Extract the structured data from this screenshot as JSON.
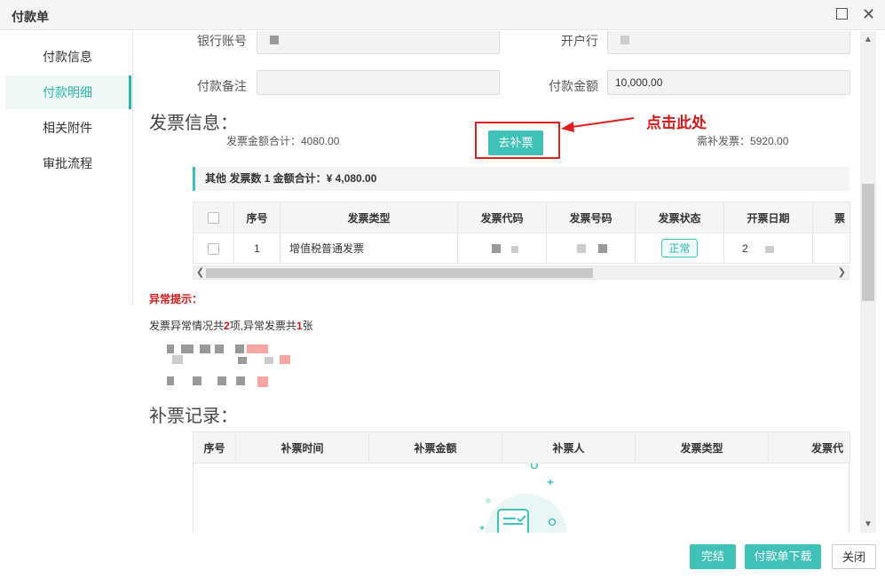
{
  "window": {
    "title": "付款单"
  },
  "sidebar": {
    "items": [
      {
        "label": "付款信息"
      },
      {
        "label": "付款明细"
      },
      {
        "label": "相关附件"
      },
      {
        "label": "审批流程"
      }
    ]
  },
  "form": {
    "bank_account_label": "银行账号",
    "bank_label": "开户行",
    "remark_label": "付款备注",
    "remark_value": "",
    "amount_label": "付款金额",
    "amount_value": "10,000.00"
  },
  "invoice": {
    "section_title": "发票信息：",
    "total_text": "发票金额合计：4080.00",
    "need_text": "需补发票：5920.00",
    "supplement_button": "去补票",
    "annotation": "点击此处",
    "group_bar": "其他 发票数 1 金额合计：¥ 4,080.00",
    "columns": [
      "序号",
      "发票类型",
      "发票代码",
      "发票号码",
      "发票状态",
      "开票日期",
      "票"
    ],
    "rows": [
      {
        "index": "1",
        "type": "增值税普通发票",
        "code": "",
        "number": "",
        "status": "正常",
        "date": "2"
      }
    ]
  },
  "warning": {
    "title": "异常提示：",
    "prefix": "发票异常情况共",
    "count1": "2",
    "mid": "项,异常发票共",
    "count2": "1",
    "suffix": "张"
  },
  "supplement": {
    "section_title": "补票记录：",
    "columns": [
      "序号",
      "补票时间",
      "补票金额",
      "补票人",
      "发票类型",
      "发票代"
    ]
  },
  "footer": {
    "complete_button": "完结",
    "download_button": "付款单下载",
    "close_button": "关闭"
  },
  "colors": {
    "accent": "#40c1b8",
    "warning": "#d11a1a"
  }
}
